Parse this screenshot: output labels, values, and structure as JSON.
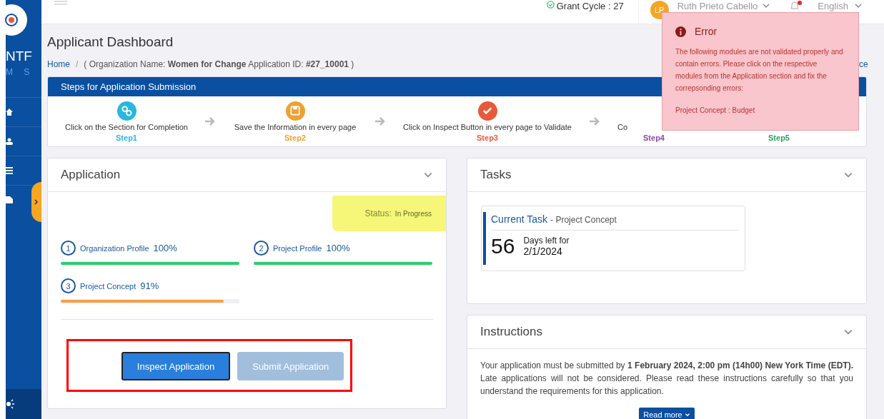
{
  "sidebar": {
    "brand": "NTF",
    "brand_sub": "M S",
    "items": [
      {
        "kind": "home"
      },
      {
        "kind": "user"
      },
      {
        "kind": "list"
      },
      {
        "kind": "file"
      }
    ]
  },
  "top_bar": {
    "grant_cycle": "Grant Cycle : 27",
    "user": {
      "initials": "LP",
      "name": "Ruth Prieto Cabello"
    },
    "language": "English"
  },
  "page": {
    "title": "Applicant Dashboard",
    "breadcrumb": {
      "home": "Home",
      "separator": "/",
      "details": "( Organization Name: **Women for Change**  Application ID: **#27_10001** )",
      "link_fragment": "ce"
    }
  },
  "steps": {
    "title": "Steps for Application Submission",
    "items": [
      {
        "kind": "link",
        "label": "Click on the Section for Completion",
        "step": "Step1",
        "color": "#29b6e0",
        "arrow_after": true
      },
      {
        "kind": "save",
        "label": "Save the Information in every page",
        "step": "Step2",
        "color": "#f0a030",
        "arrow_after": true
      },
      {
        "kind": "check",
        "label": "Click on Inspect Button in every page to Validate",
        "step": "Step3",
        "color": "#e8583a",
        "arrow_after": true
      },
      {
        "kind": "hidden",
        "label": "Co",
        "step": "Step4",
        "color": "#8e44ad",
        "arrow_after": false
      },
      {
        "kind": "hidden",
        "step": "Step5",
        "color": "#2e9d5a",
        "arrow_after": false
      }
    ]
  },
  "application": {
    "title": "Application",
    "status_label": "Status:",
    "status": "In Progress",
    "modules": [
      {
        "number": "1",
        "name": "Organization Profile",
        "percent": "100%",
        "level": 1.0,
        "color": "#2ecc71"
      },
      {
        "number": "2",
        "name": "Project Profile",
        "percent": "100%",
        "level": 1.0,
        "color": "#2ecc71"
      },
      {
        "number": "3",
        "name": "Project Concept",
        "percent": "91%",
        "level": 0.91,
        "color": "#f5a04a"
      }
    ],
    "buttons": [
      {
        "label": "Inspect Application",
        "kind": "primary",
        "disabled": false
      },
      {
        "label": "Submit Application",
        "kind": "secondary",
        "disabled": true
      }
    ]
  },
  "tasks": {
    "title": "Tasks",
    "current_task": {
      "label": "Current Task",
      "name": "- Project Concept",
      "days": "56",
      "days_label": "Days left for",
      "date": "2/1/2024"
    }
  },
  "instructions": {
    "title": "Instructions",
    "text": "Your application must be submitted by **1 February 2024, 2:00 pm (14h00) New York Time (EDT).** Late applications will not be considered. Please read these instructions carefully so that you understand the requirements for this application.",
    "button": "Read more"
  },
  "error_popup": {
    "title": "Error",
    "message": "The following modules are not validated properly and contain errors. Please click on the respective modules from the Application section and fix the correpsonding errors:",
    "detail": "Project Concept : Budget"
  }
}
